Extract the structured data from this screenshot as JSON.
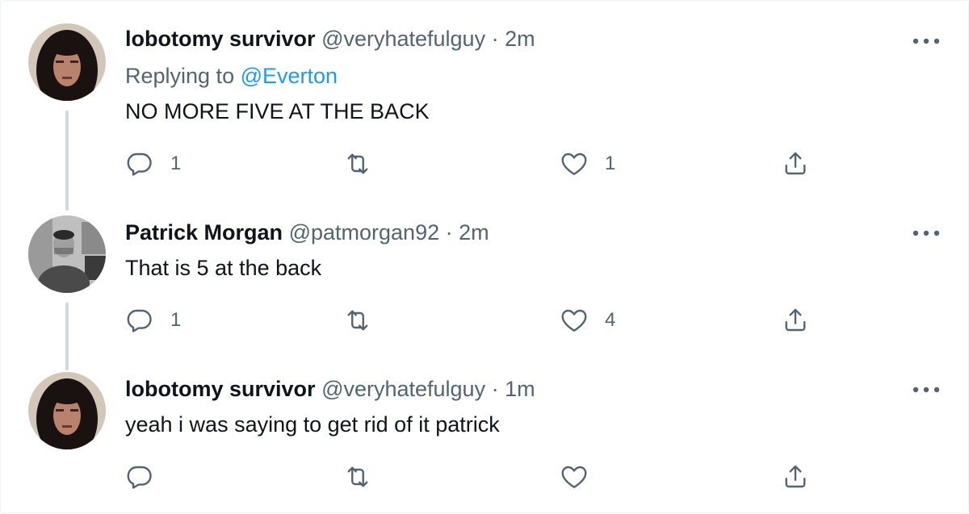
{
  "tweets": [
    {
      "display_name": "lobotomy survivor",
      "handle": "@veryhatefulguy",
      "separator": "·",
      "time": "2m",
      "replying_label": "Replying to",
      "replying_to": "@Everton",
      "text": "NO MORE FIVE AT THE BACK",
      "reply_count": "1",
      "retweet_count": "",
      "like_count": "1"
    },
    {
      "display_name": "Patrick Morgan",
      "handle": "@patmorgan92",
      "separator": "·",
      "time": "2m",
      "text": "That is 5 at the back",
      "reply_count": "1",
      "retweet_count": "",
      "like_count": "4"
    },
    {
      "display_name": "lobotomy survivor",
      "handle": "@veryhatefulguy",
      "separator": "·",
      "time": "1m",
      "text": "yeah i was saying to get rid of it patrick",
      "reply_count": "",
      "retweet_count": "",
      "like_count": ""
    }
  ],
  "icons": {
    "reply": "reply-icon",
    "retweet": "retweet-icon",
    "like": "heart-icon",
    "share": "share-icon",
    "more": "more-icon"
  },
  "colors": {
    "text_primary": "#0f1419",
    "text_secondary": "#536471",
    "link": "#1d9bf0",
    "thread_line": "#cfd9de"
  }
}
